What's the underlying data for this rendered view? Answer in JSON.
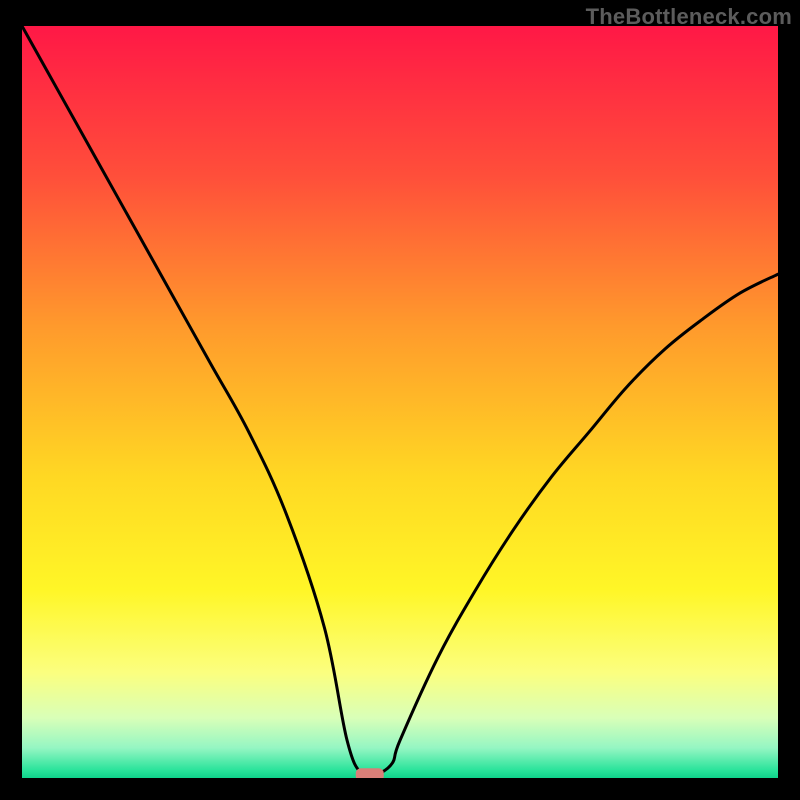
{
  "watermark": "TheBottleneck.com",
  "chart_data": {
    "type": "line",
    "title": "",
    "xlabel": "",
    "ylabel": "",
    "xlim": [
      0,
      100
    ],
    "ylim": [
      0,
      100
    ],
    "grid": false,
    "x": [
      0,
      5,
      10,
      15,
      20,
      25,
      30,
      35,
      40,
      43,
      45,
      47,
      49,
      50,
      55,
      60,
      65,
      70,
      75,
      80,
      85,
      90,
      95,
      100
    ],
    "values": [
      100,
      91,
      82,
      73,
      64,
      55,
      46,
      35,
      20,
      5,
      0.5,
      0.5,
      2,
      5,
      16,
      25,
      33,
      40,
      46,
      52,
      57,
      61,
      64.5,
      67
    ],
    "optimum_marker": {
      "x": 46,
      "y": 0.5
    },
    "background": {
      "type": "vertical-gradient",
      "stops": [
        {
          "pct": 0,
          "color": "#ff1846"
        },
        {
          "pct": 20,
          "color": "#ff4f3a"
        },
        {
          "pct": 40,
          "color": "#ff9a2c"
        },
        {
          "pct": 60,
          "color": "#ffd823"
        },
        {
          "pct": 75,
          "color": "#fff627"
        },
        {
          "pct": 86,
          "color": "#fbff7f"
        },
        {
          "pct": 92,
          "color": "#d9ffb8"
        },
        {
          "pct": 96,
          "color": "#95f6c3"
        },
        {
          "pct": 99,
          "color": "#28e39a"
        },
        {
          "pct": 100,
          "color": "#0fd38b"
        }
      ]
    }
  },
  "plot_geometry": {
    "inner_x": 22,
    "inner_y": 26,
    "inner_w": 756,
    "inner_h": 752
  }
}
